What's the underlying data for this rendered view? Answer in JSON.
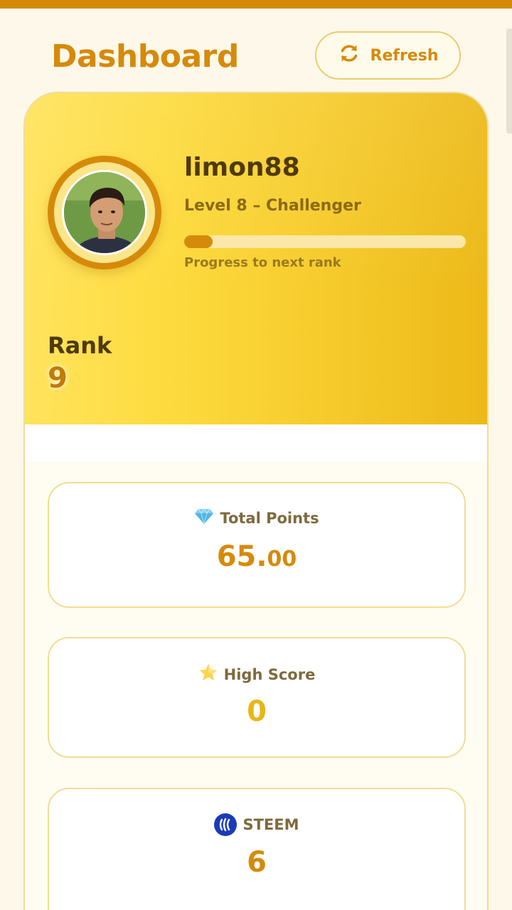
{
  "header": {
    "title": "Dashboard",
    "refresh_label": "Refresh"
  },
  "profile": {
    "username": "limon88",
    "level": "Level 8 – Challenger",
    "progress_label": "Progress to next rank",
    "progress_fraction": 0.1
  },
  "rank": {
    "label": "Rank",
    "value": "9"
  },
  "stats": [
    {
      "icon": "gem-icon",
      "title": "Total Points",
      "value_int": "65.",
      "value_dec": "00",
      "color": "#d68a0a"
    },
    {
      "icon": "star-icon",
      "title": "High Score",
      "value": "0",
      "color": "#e8b616"
    },
    {
      "icon": "steem-icon",
      "title": "STEEM",
      "value": "6",
      "color": "#d68a0a"
    }
  ],
  "colors": {
    "accent": "#d68a0a",
    "hero_start": "#ffe35c",
    "hero_end": "#ecb918",
    "background": "#fdf8ea"
  }
}
